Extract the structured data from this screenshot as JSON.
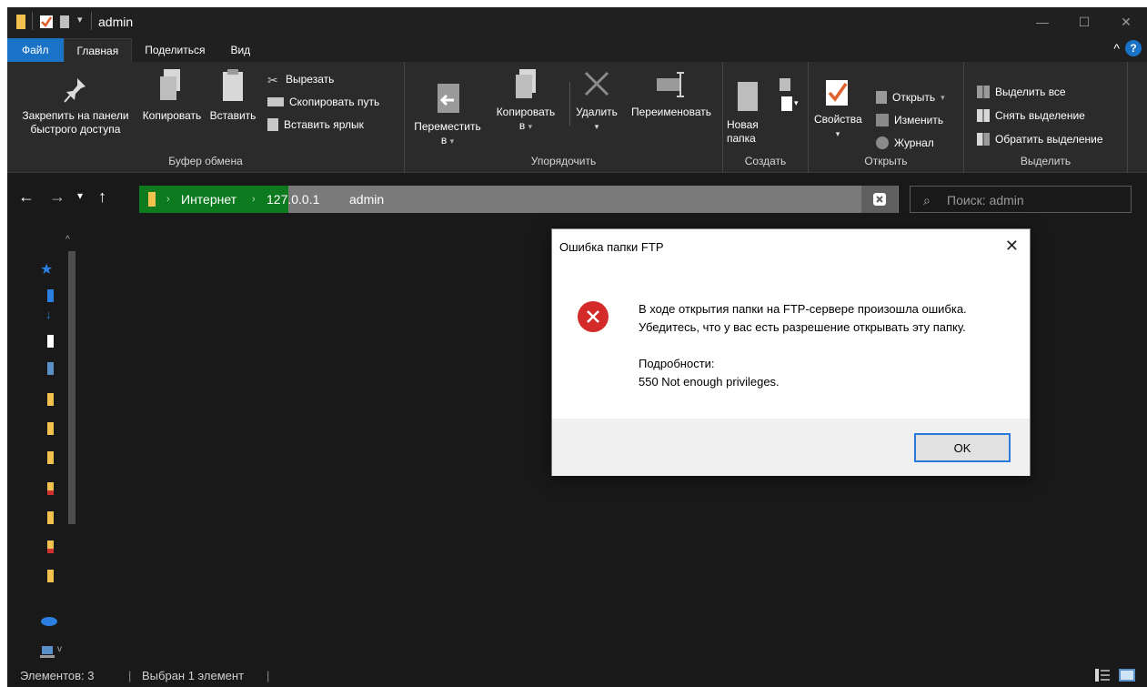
{
  "window": {
    "title": "admin"
  },
  "titlebar": {
    "controls": [
      "—",
      "☐",
      "✕"
    ]
  },
  "tabs": [
    "Файл",
    "Главная",
    "Поделиться",
    "Вид"
  ],
  "ribbon": {
    "clipboard": {
      "pin_line1": "Закрепить на панели",
      "pin_line2": "быстрого доступа",
      "copy": "Копировать",
      "paste": "Вставить",
      "cut": "Вырезать",
      "copy_path": "Скопировать путь",
      "paste_shortcut": "Вставить ярлык",
      "label": "Буфер обмена"
    },
    "organize": {
      "move_line1": "Переместить",
      "move_line2": "в",
      "copy_line1": "Копировать",
      "copy_line2": "в",
      "delete": "Удалить",
      "rename": "Переименовать",
      "label": "Упорядочить"
    },
    "new": {
      "folder_line1": "Новая",
      "folder_line2": "папка",
      "label": "Создать"
    },
    "open": {
      "properties": "Свойства",
      "open": "Открыть",
      "edit": "Изменить",
      "history": "Журнал",
      "label": "Открыть"
    },
    "select": {
      "select_all": "Выделить все",
      "select_none": "Снять выделение",
      "invert": "Обратить выделение",
      "label": "Выделить"
    }
  },
  "address": {
    "crumbs": [
      "Интернет",
      "127.0.0.1",
      "admin"
    ],
    "search_placeholder": "Поиск: admin"
  },
  "status": {
    "items": "Элементов: 3",
    "selected": "Выбран 1 элемент"
  },
  "dialog": {
    "title": "Ошибка папки FTP",
    "line1": "В ходе открытия папки на FTP-сервере произошла ошибка.",
    "line2": "Убедитесь, что у вас есть разрешение открывать эту папку.",
    "details_label": "Подробности:",
    "details": "550 Not enough privileges.",
    "ok": "OK"
  },
  "colors": {
    "accent": "#1a73c6",
    "address_green": "#0d7a1f",
    "error_red": "#d42a2a"
  }
}
